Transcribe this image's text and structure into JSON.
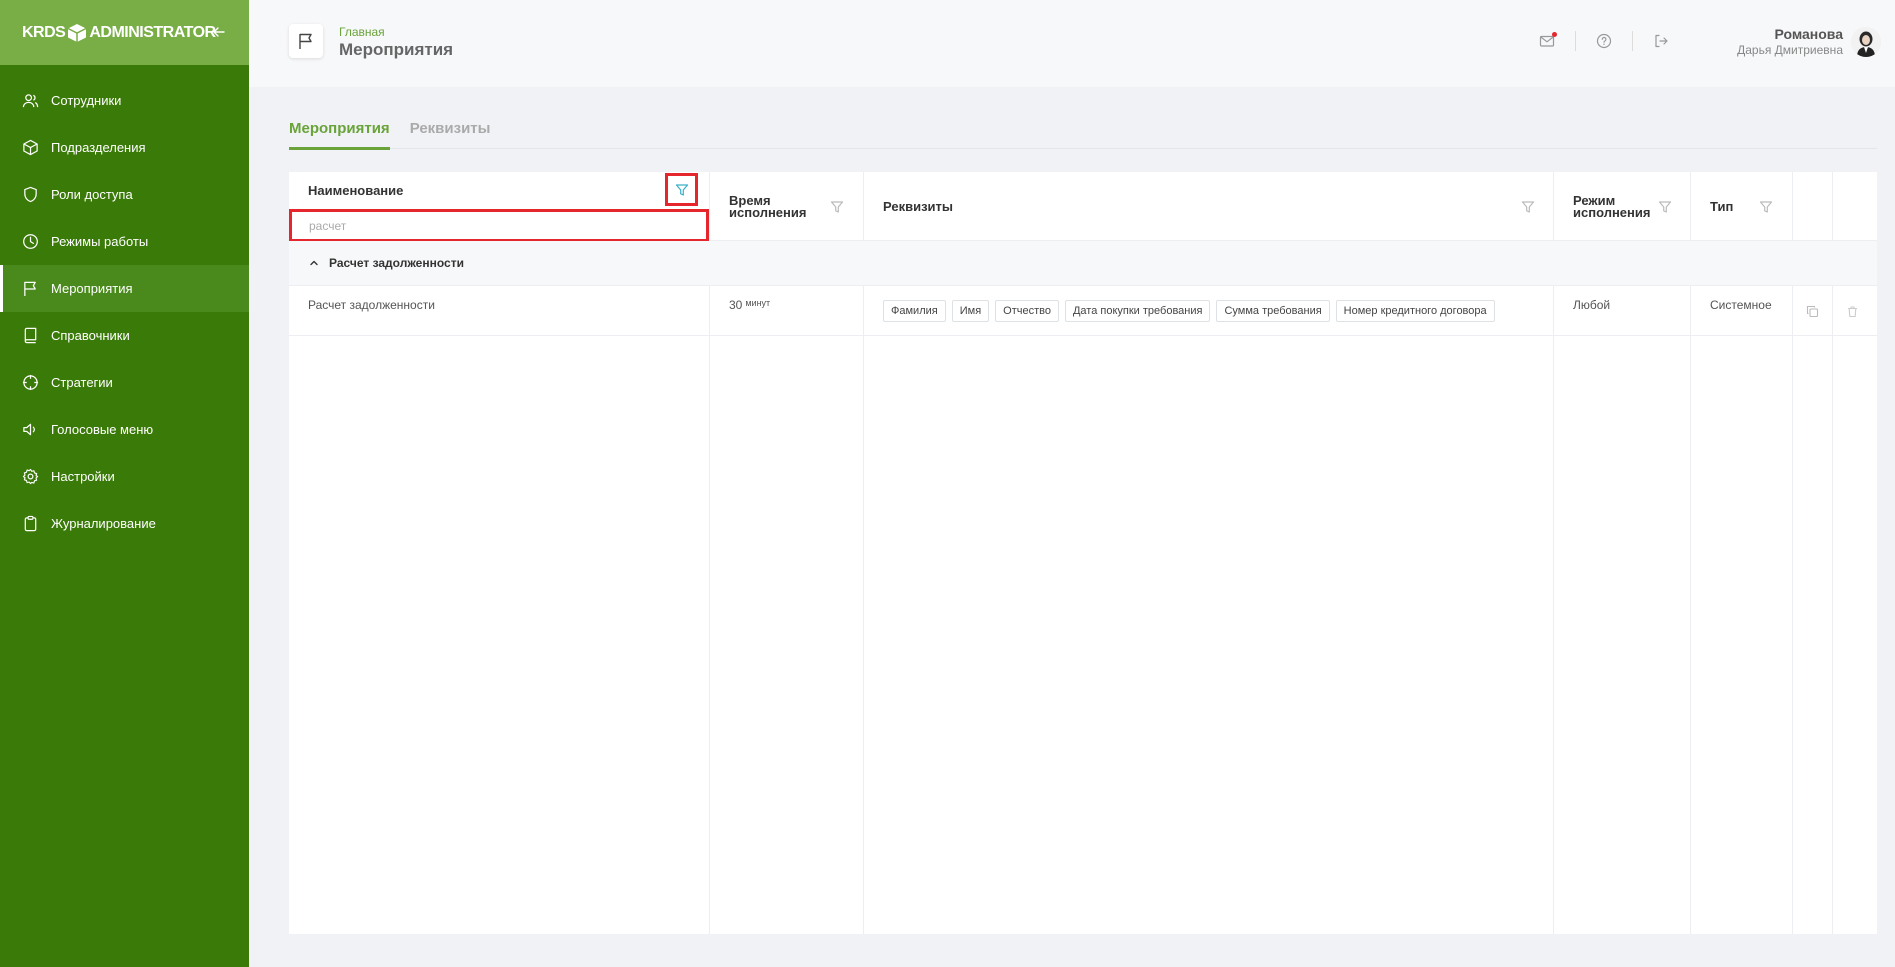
{
  "sidebar": {
    "logo_left": "KRDS",
    "logo_right": "ADMINISTRATOR",
    "items": [
      {
        "label": "Сотрудники",
        "icon": "users-icon"
      },
      {
        "label": "Подразделения",
        "icon": "cube-icon"
      },
      {
        "label": "Роли доступа",
        "icon": "shield-icon"
      },
      {
        "label": "Режимы работы",
        "icon": "clock-icon"
      },
      {
        "label": "Мероприятия",
        "icon": "flag-icon",
        "active": true
      },
      {
        "label": "Справочники",
        "icon": "book-icon"
      },
      {
        "label": "Стратегии",
        "icon": "crosshair-icon"
      },
      {
        "label": "Голосовые меню",
        "icon": "speaker-icon"
      },
      {
        "label": "Настройки",
        "icon": "gear-icon"
      },
      {
        "label": "Журналирование",
        "icon": "clipboard-icon"
      }
    ]
  },
  "header": {
    "breadcrumb": "Главная",
    "title": "Мероприятия",
    "user_last_name": "Романова",
    "user_first_name": "Дарья Дмитриевна"
  },
  "tabs": [
    {
      "label": "Мероприятия",
      "active": true
    },
    {
      "label": "Реквизиты",
      "active": false
    }
  ],
  "table": {
    "columns": {
      "name": "Наименование",
      "time": "Время исполнения",
      "requisites": "Реквизиты",
      "mode": "Режим исполнения",
      "type": "Тип"
    },
    "search": {
      "value": "",
      "placeholder": "расчет"
    },
    "group_label": "Расчет задолженности",
    "rows": [
      {
        "name": "Расчет задолженности",
        "time_value": "30",
        "time_unit": "минут",
        "requisites": [
          "Фамилия",
          "Имя",
          "Отчество",
          "Дата покупки требования",
          "Сумма требования",
          "Номер кредитного договора"
        ],
        "mode": "Любой",
        "type": "Системное"
      }
    ]
  },
  "colors": {
    "sidebar_bg": "#3a7a08",
    "sidebar_top_bg": "#79ad46",
    "accent": "#6aa339",
    "highlight": "#e5262d"
  }
}
